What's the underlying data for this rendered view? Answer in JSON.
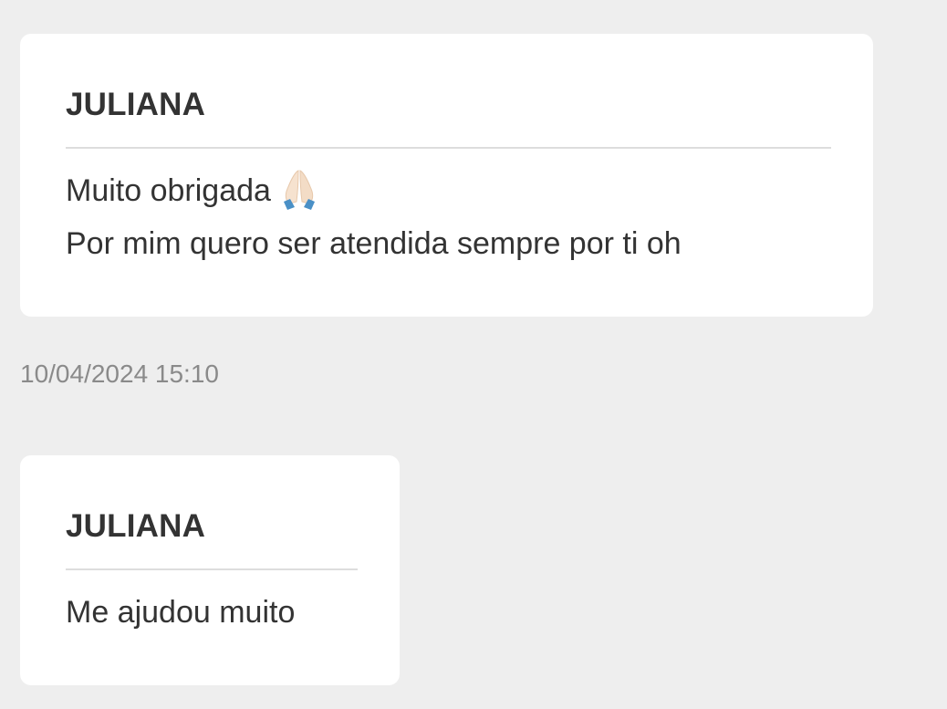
{
  "messages": [
    {
      "sender": "JULIANA",
      "lines": [
        "Muito obrigada",
        "Por mim quero ser atendida sempre por ti oh"
      ],
      "emoji": "folded-hands"
    },
    {
      "sender": "JULIANA",
      "lines": [
        "Me ajudou muito"
      ]
    }
  ],
  "timestamp": "10/04/2024 15:10",
  "colors": {
    "background": "#eeeeee",
    "bubble": "#ffffff",
    "text": "#333333",
    "timestamp": "#8a8a8a",
    "divider": "#dddddd"
  }
}
